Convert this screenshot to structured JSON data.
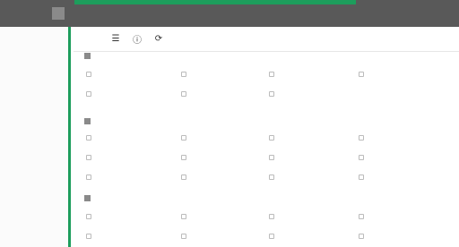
{
  "top": {
    "title": "",
    "right_text": ""
  },
  "sidebar": {
    "items": [
      "",
      "",
      "",
      "",
      "",
      "",
      "",
      "",
      "",
      "",
      "",
      "",
      "",
      ""
    ]
  },
  "toolbar": {
    "label": ""
  },
  "sections": [
    {
      "title": "",
      "links": [
        "",
        "",
        "",
        "",
        "",
        "",
        "",
        ""
      ]
    },
    {
      "title": "",
      "links": [
        "",
        "",
        "",
        "",
        "",
        "",
        "",
        "",
        "",
        "",
        "",
        ""
      ]
    },
    {
      "title": "",
      "links": [
        "",
        "",
        "",
        "",
        "",
        "",
        "",
        "",
        ""
      ]
    }
  ],
  "colors": {
    "accent": "#1d9d5c",
    "topbar": "#595959"
  }
}
